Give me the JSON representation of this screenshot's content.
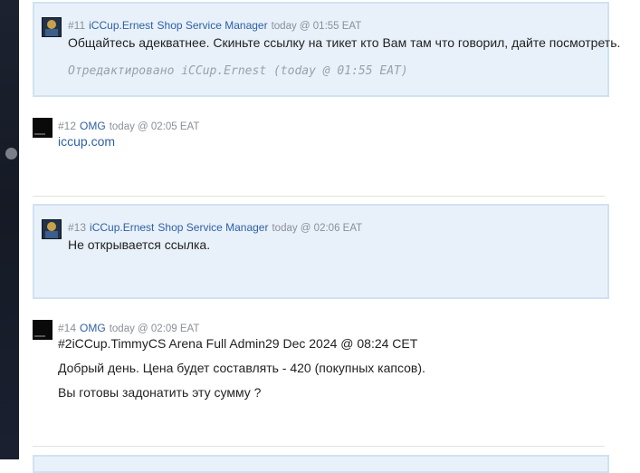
{
  "posts": [
    {
      "number": "#11",
      "author": "iCCup.Ernest",
      "role": "Shop Service Manager",
      "time": "today @ 01:55 EAT",
      "lines": [
        "Общайтесь адекватнее. Скиньте ссылку на тикет кто Вам там что говорил, дайте посмотреть."
      ],
      "edited": "Отредактировано iCCup.Ernest (today @ 01:55 EAT)"
    },
    {
      "number": "#12",
      "author": "OMG",
      "time": "today @ 02:05 EAT",
      "link": "iccup.com"
    },
    {
      "number": "#13",
      "author": "iCCup.Ernest",
      "role": "Shop Service Manager",
      "time": "today @ 02:06 EAT",
      "lines": [
        "Не открывается ссылка."
      ]
    },
    {
      "number": "#14",
      "author": "OMG",
      "time": "today @ 02:09 EAT",
      "lines": [
        "#2iCCup.TimmyCS Arena Full Admin29 Dec 2024 @ 08:24 CET",
        "Добрый день. Цена будет составлять - 420 (покупных капсов).",
        "Вы готовы задонатить эту сумму ?"
      ]
    }
  ]
}
